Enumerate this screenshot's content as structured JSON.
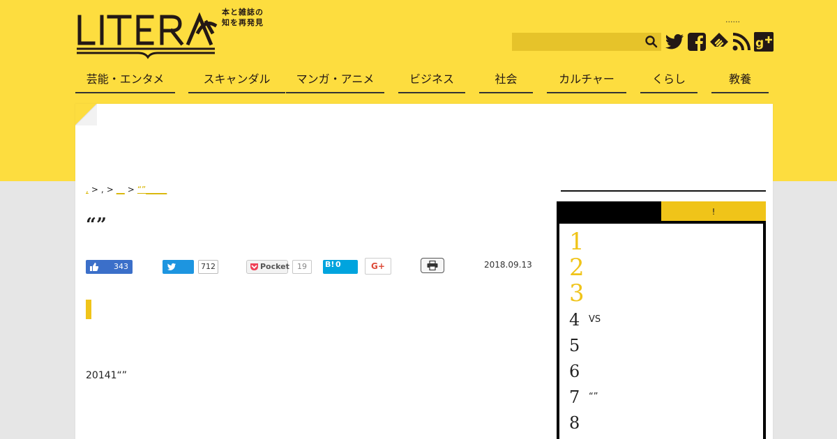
{
  "header": {
    "logo_text": "LITERA",
    "tagline_line1": "本と雑誌の",
    "tagline_line2": "知を再発見",
    "top_dots": "......"
  },
  "search": {
    "placeholder": ""
  },
  "social_icons": [
    "twitter-icon",
    "facebook-icon",
    "feedly-icon",
    "rss-icon",
    "google-plus-icon"
  ],
  "nav": {
    "items": [
      "芸能・エンタメ",
      "スキャンダル",
      "マンガ・アニメ",
      "ビジネス",
      "社会",
      "カルチャー",
      "くらし",
      "教養"
    ]
  },
  "breadcrumb": {
    "item1": ",",
    "item2": ",",
    "item3": "__",
    "item4": "“”_____",
    "separator": ">"
  },
  "article": {
    "title": "“”",
    "date": "2018.09.13",
    "body_text": "20141“”"
  },
  "share": {
    "facebook_count": "343",
    "twitter_count": "712",
    "pocket_label": "Pocket",
    "pocket_count": "19",
    "hatena_label": "B!",
    "hatena_count": "0",
    "gplus_label": "G+"
  },
  "sidebar": {
    "tab_active": "",
    "tab_other": "!",
    "ranking": [
      {
        "num": "1",
        "text": ""
      },
      {
        "num": "2",
        "text": ""
      },
      {
        "num": "3",
        "text": ""
      },
      {
        "num": "4",
        "text": "VS"
      },
      {
        "num": "5",
        "text": ""
      },
      {
        "num": "6",
        "text": ""
      },
      {
        "num": "7",
        "text": "“”"
      },
      {
        "num": "8",
        "text": ""
      }
    ]
  },
  "colors": {
    "brand_yellow": "#fddd3f",
    "accent_yellow": "#f0c419",
    "background_gray": "#e6e6e6"
  }
}
